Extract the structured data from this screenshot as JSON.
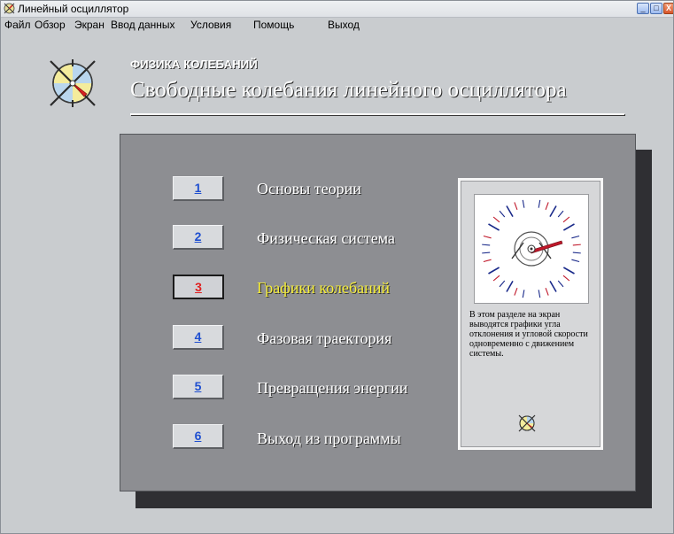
{
  "window": {
    "title": "Линейный осциллятор",
    "controls": {
      "minimize": "_",
      "maximize": "□",
      "close": "X"
    }
  },
  "menu": [
    "Файл",
    "Обзор",
    "Экран",
    "Ввод данных",
    "Условия",
    "Помощь",
    "Выход"
  ],
  "header": {
    "subtitle": "ФИЗИКА КОЛЕБАНИЙ",
    "title": "Свободные колебания линейного осциллятора"
  },
  "nav": [
    {
      "number": "1",
      "label": "Основы теории",
      "active": false
    },
    {
      "number": "2",
      "label": "Физическая система",
      "active": false
    },
    {
      "number": "3",
      "label": "Графики колебаний",
      "active": true
    },
    {
      "number": "4",
      "label": "Фазовая траектория",
      "active": false
    },
    {
      "number": "5",
      "label": "Превращения энергии",
      "active": false
    },
    {
      "number": "6",
      "label": "Выход из программы",
      "active": false
    }
  ],
  "info": {
    "description": "В этом разделе на экран выводятся графики угла отклонения и угловой скорости одновременно с движением системы."
  },
  "colors": {
    "panel": "#8d8e92",
    "accent_active_label": "#f6ee3a",
    "button_number": "#1f4fd0",
    "button_number_active": "#e02020",
    "clock_ticks": "#1a2a8a",
    "clock_ticks_accent": "#c0182a"
  },
  "icons": [
    "app-icon",
    "oscillator-logo-icon",
    "clock-dial-icon",
    "oscillator-mini-icon"
  ]
}
